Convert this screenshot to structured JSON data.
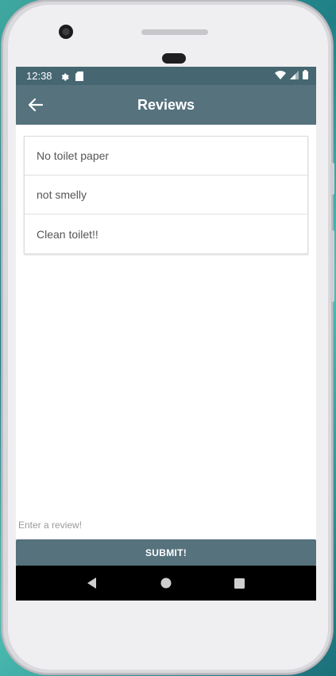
{
  "status_bar": {
    "time": "12:38",
    "icons": [
      "gear-icon",
      "sd-card-icon",
      "wifi-icon",
      "cell-signal-icon",
      "battery-icon"
    ]
  },
  "app_bar": {
    "title": "Reviews",
    "back_icon": "arrow-left-icon"
  },
  "reviews": [
    "No toilet paper",
    "not smelly",
    "Clean toilet!!"
  ],
  "review_input": {
    "value": "",
    "placeholder": "Enter a review!"
  },
  "submit_label": "SUBMIT!",
  "nav_bar": {
    "icons": [
      "back-triangle-icon",
      "home-circle-icon",
      "recents-square-icon"
    ]
  },
  "colors": {
    "status_bar": "#466772",
    "app_bar": "#55727d",
    "button": "#55727d",
    "nav_bar": "#000000"
  }
}
